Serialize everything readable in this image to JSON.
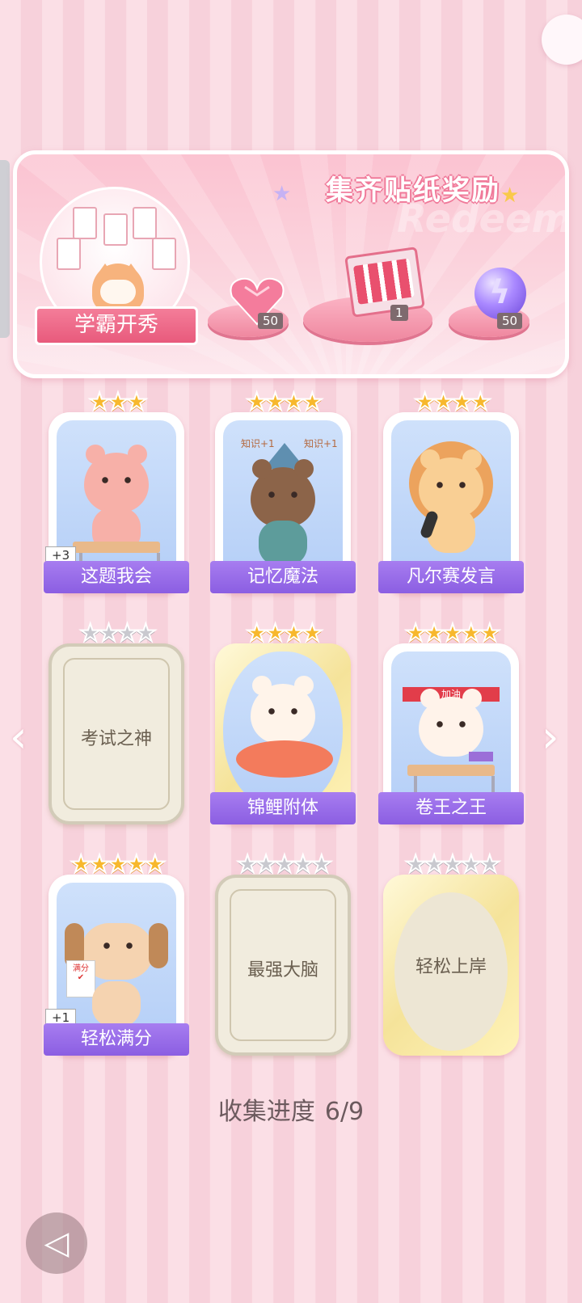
{
  "banner": {
    "title": "集齐贴纸奖励",
    "watermark": "Redeem",
    "badge": "学霸开秀",
    "rewards": [
      {
        "icon": "pink-heart-gem-icon",
        "count": "50"
      },
      {
        "icon": "gift-box-icon",
        "count": "1"
      },
      {
        "icon": "purple-energy-orb-icon",
        "count": "50"
      }
    ]
  },
  "cards": [
    {
      "label": "这题我会",
      "stars": 3,
      "status": "collected",
      "badge": "+3"
    },
    {
      "label": "记忆魔法",
      "stars": 4,
      "status": "collected",
      "art_text": [
        "知识+1",
        "知识+1"
      ]
    },
    {
      "label": "凡尔赛发言",
      "stars": 4,
      "status": "collected"
    },
    {
      "label": "考试之神",
      "stars": 4,
      "status": "locked"
    },
    {
      "label": "锦鲤附体",
      "stars": 4,
      "status": "collected"
    },
    {
      "label": "卷王之王",
      "stars": 5,
      "status": "collected",
      "art_text": [
        "加油"
      ]
    },
    {
      "label": "轻松满分",
      "stars": 5,
      "status": "collected",
      "badge": "+1",
      "art_text": [
        "满分"
      ]
    },
    {
      "label": "最强大脑",
      "stars": 5,
      "status": "locked"
    },
    {
      "label": "轻松上岸",
      "stars": 5,
      "status": "locked"
    }
  ],
  "progress": {
    "label": "收集进度",
    "value": "6/9"
  },
  "nav": {
    "prev_icon": "chevron-left-icon",
    "next_icon": "chevron-right-icon",
    "back_icon": "back-icon"
  }
}
